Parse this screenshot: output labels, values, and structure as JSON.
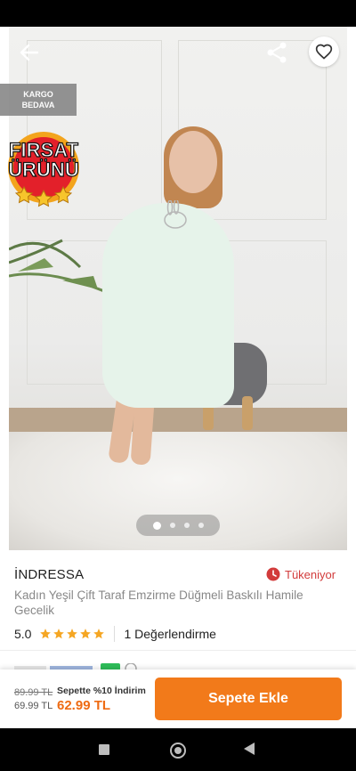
{
  "badges": {
    "shipping_line1": "KARGO",
    "shipping_line2": "BEDAVA",
    "deal_line1": "FIRSAT",
    "deal_line2": "ÜRÜNÜ"
  },
  "gallery": {
    "total_images": 4,
    "current_index": 1
  },
  "product": {
    "brand": "İNDRESSA",
    "title": "Kadın Yeşil  Çift Taraf Emzirme Düğmeli Baskılı Hamile Gecelik",
    "stock_status": "Tükeniyor",
    "rating": "5.0",
    "rating_stars": 5,
    "review_count": "1 Değerlendirme"
  },
  "pricing": {
    "old_price": "89.99 TL",
    "discounted_price": "69.99 TL",
    "cart_discount_label": "Sepette %10 İndirim",
    "final_price": "62.99 TL"
  },
  "actions": {
    "add_to_cart": "Sepete Ekle"
  },
  "icons": {
    "back": "arrow-left-icon",
    "share": "share-icon",
    "favorite": "heart-icon",
    "stock_alert": "clock-icon"
  },
  "colors": {
    "accent": "#f27a1a",
    "price": "#ee6b13",
    "alert": "#d23b3b",
    "star": "#f5a623"
  }
}
